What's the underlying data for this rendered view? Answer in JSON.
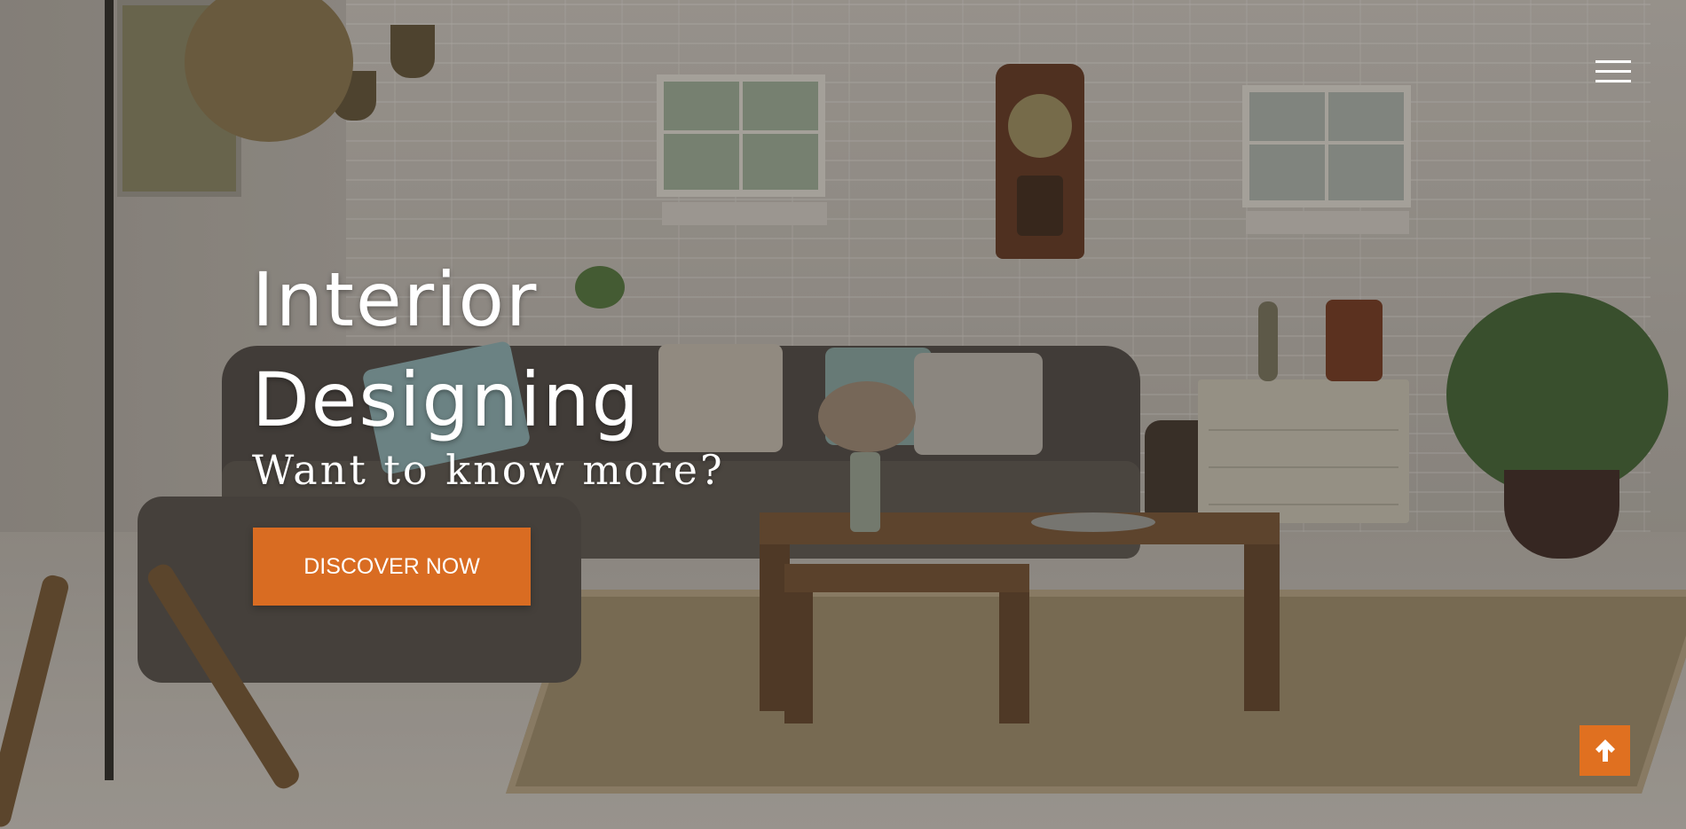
{
  "hero": {
    "title": "Interior Designing",
    "subtitle": "Want to know more?",
    "cta_label": "DISCOVER NOW"
  },
  "header": {
    "menu_icon": "hamburger-menu-icon"
  },
  "footer": {
    "back_to_top_icon": "arrow-up-icon"
  },
  "colors": {
    "accent": "#d96c22",
    "text": "#ffffff"
  }
}
